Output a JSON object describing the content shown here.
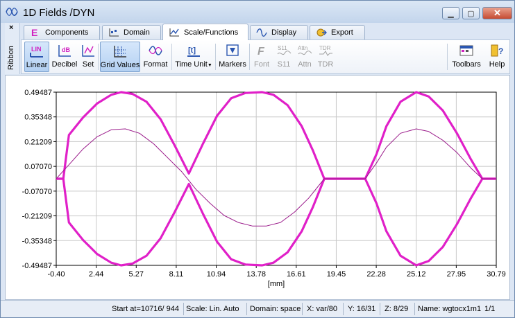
{
  "window": {
    "title": "1D Fields /DYN",
    "minimize_glyph": "▁",
    "maximize_glyph": "▢",
    "close_glyph": "✕",
    "accent": "#dd22cc"
  },
  "ribbon": {
    "collapse_glyph": "×",
    "label": "Ribbon"
  },
  "tabs": [
    {
      "label": "Components",
      "icon": "components-icon"
    },
    {
      "label": "Domain",
      "icon": "domain-icon"
    },
    {
      "label": "Scale/Functions",
      "icon": "scale-functions-icon",
      "active": true
    },
    {
      "label": "Display",
      "icon": "display-icon"
    },
    {
      "label": "Export",
      "icon": "export-icon"
    }
  ],
  "toolbar": {
    "linear": "Linear",
    "decibel": "Decibel",
    "set": "Set",
    "grid_values": "Grid Values",
    "format": "Format",
    "time_unit": "Time Unit",
    "markers": "Markers",
    "font": "Font",
    "s11": "S11",
    "attn": "Attn",
    "tdr": "TDR",
    "toolbars": "Toolbars",
    "help": "Help",
    "icon_text": {
      "linear": "LIN",
      "decibel": "dB",
      "time_unit": "[t]",
      "font": "F",
      "s11": "S11",
      "attn": "Attn",
      "tdr": "TDR",
      "help": "?"
    }
  },
  "chart_data": {
    "type": "line",
    "xlabel": "[mm]",
    "ylabel": "",
    "xlim": [
      -0.4,
      30.79
    ],
    "ylim": [
      -0.49487,
      0.49487
    ],
    "x_ticks": [
      "-0.40",
      "2.44",
      "5.27",
      "8.11",
      "10.94",
      "13.78",
      "16.61",
      "19.45",
      "22.28",
      "25.12",
      "27.95",
      "30.79"
    ],
    "y_ticks": [
      "0.49487",
      "0.35348",
      "0.21209",
      "0.07070",
      "-0.07070",
      "-0.21209",
      "-0.35348",
      "-0.49487"
    ],
    "grid": true,
    "colors": {
      "series": "#e020c8",
      "thin": "#9a1a8a",
      "grid": "#c8c8c8"
    },
    "series": [
      {
        "x": [
          -0.4,
          0.1,
          0.5,
          1.5,
          2.5,
          3.5,
          4.2,
          5.0,
          6.0,
          7.0,
          8.0,
          9.0,
          10.0,
          11.0,
          12.0,
          13.0,
          14.2,
          15.0,
          16.0,
          17.0,
          17.8,
          18.6,
          19.45,
          20.2,
          21.0,
          21.5,
          22.3,
          23.0,
          24.0,
          25.12,
          26.0,
          27.0,
          28.0,
          29.0,
          29.8,
          30.79
        ],
        "y": [
          0.0,
          0.0,
          0.25,
          0.35,
          0.43,
          0.48,
          0.49487,
          0.485,
          0.44,
          0.34,
          0.19,
          0.03,
          0.2,
          0.36,
          0.46,
          0.49,
          0.49487,
          0.48,
          0.42,
          0.3,
          0.16,
          0.0,
          0.0,
          0.0,
          0.0,
          0.0,
          0.14,
          0.3,
          0.44,
          0.49487,
          0.47,
          0.39,
          0.26,
          0.11,
          0.0,
          0.0
        ]
      },
      {
        "x": [
          -0.4,
          0.1,
          0.5,
          1.5,
          2.5,
          3.5,
          4.2,
          5.0,
          6.0,
          7.0,
          8.0,
          9.0,
          10.0,
          11.0,
          12.0,
          13.0,
          14.2,
          15.0,
          16.0,
          17.0,
          17.8,
          18.6,
          19.45,
          20.2,
          21.0,
          21.5,
          22.3,
          23.0,
          24.0,
          25.12,
          26.0,
          27.0,
          28.0,
          29.0,
          29.8,
          30.79
        ],
        "y": [
          0.0,
          0.0,
          -0.25,
          -0.35,
          -0.43,
          -0.48,
          -0.49487,
          -0.485,
          -0.44,
          -0.34,
          -0.19,
          -0.03,
          -0.2,
          -0.36,
          -0.46,
          -0.49,
          -0.49487,
          -0.48,
          -0.42,
          -0.3,
          -0.16,
          0.0,
          0.0,
          0.0,
          0.0,
          0.0,
          -0.14,
          -0.3,
          -0.44,
          -0.49487,
          -0.47,
          -0.39,
          -0.26,
          -0.11,
          0.0,
          0.0
        ]
      },
      {
        "x": [
          -0.4,
          0.5,
          1.5,
          2.5,
          3.5,
          4.5,
          5.5,
          6.5,
          7.5,
          8.5,
          9.5,
          10.5,
          11.5,
          12.5,
          13.5,
          14.5,
          15.5,
          16.5,
          17.5,
          18.6,
          19.45,
          21.0,
          21.5,
          22.3,
          23.0,
          24.0,
          25.12,
          26.0,
          27.0,
          28.0,
          29.0,
          29.8,
          30.79
        ],
        "y": [
          0.0,
          0.08,
          0.17,
          0.24,
          0.28,
          0.285,
          0.26,
          0.2,
          0.12,
          0.04,
          -0.06,
          -0.14,
          -0.21,
          -0.25,
          -0.27,
          -0.27,
          -0.25,
          -0.19,
          -0.11,
          0.0,
          0.0,
          0.0,
          0.0,
          0.09,
          0.18,
          0.26,
          0.285,
          0.27,
          0.22,
          0.15,
          0.06,
          0.0,
          0.0
        ]
      }
    ]
  },
  "status": {
    "start": "Start at=10716/ 944",
    "scale": "Scale: Lin. Auto",
    "domain": "Domain: space",
    "x": "X: var/80",
    "y": "Y: 16/31",
    "z": "Z: 8/29",
    "name": "Name:  wgtocx1m1",
    "page": "1/1"
  }
}
